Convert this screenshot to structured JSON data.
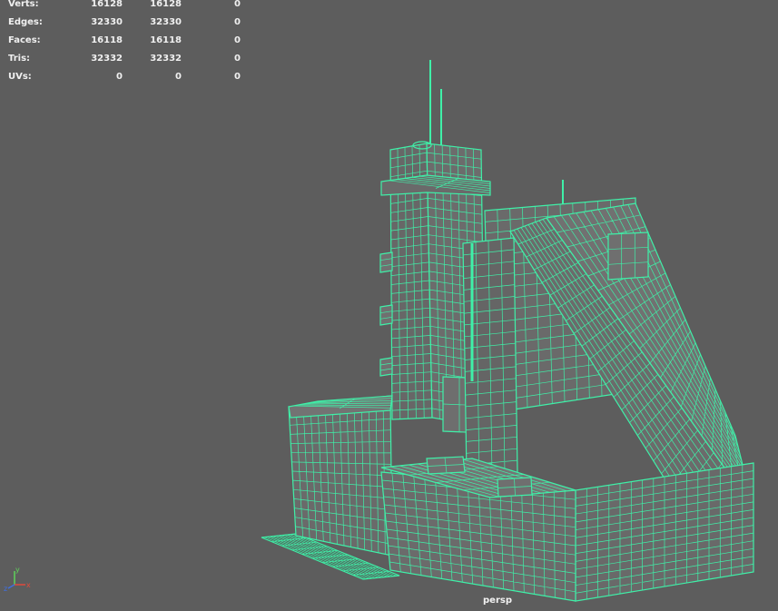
{
  "hud": {
    "rows": [
      {
        "label": "Verts:",
        "a": "16128",
        "b": "16128",
        "c": "0"
      },
      {
        "label": "Edges:",
        "a": "32330",
        "b": "32330",
        "c": "0"
      },
      {
        "label": "Faces:",
        "a": "16118",
        "b": "16118",
        "c": "0"
      },
      {
        "label": "Tris:",
        "a": "32332",
        "b": "32332",
        "c": "0"
      },
      {
        "label": "UVs:",
        "a": "0",
        "b": "0",
        "c": "0"
      }
    ]
  },
  "viewport": {
    "camera_label": "persp",
    "background_color": "#5d5d5d",
    "wireframe_color": "#3ff0a8"
  },
  "axis_indicator": {
    "icon": "view-axis-icon",
    "x_label": "x",
    "y_label": "y",
    "z_label": "z",
    "x_color": "#e04a3c",
    "y_color": "#5fd35a",
    "z_color": "#3f6fe0"
  }
}
